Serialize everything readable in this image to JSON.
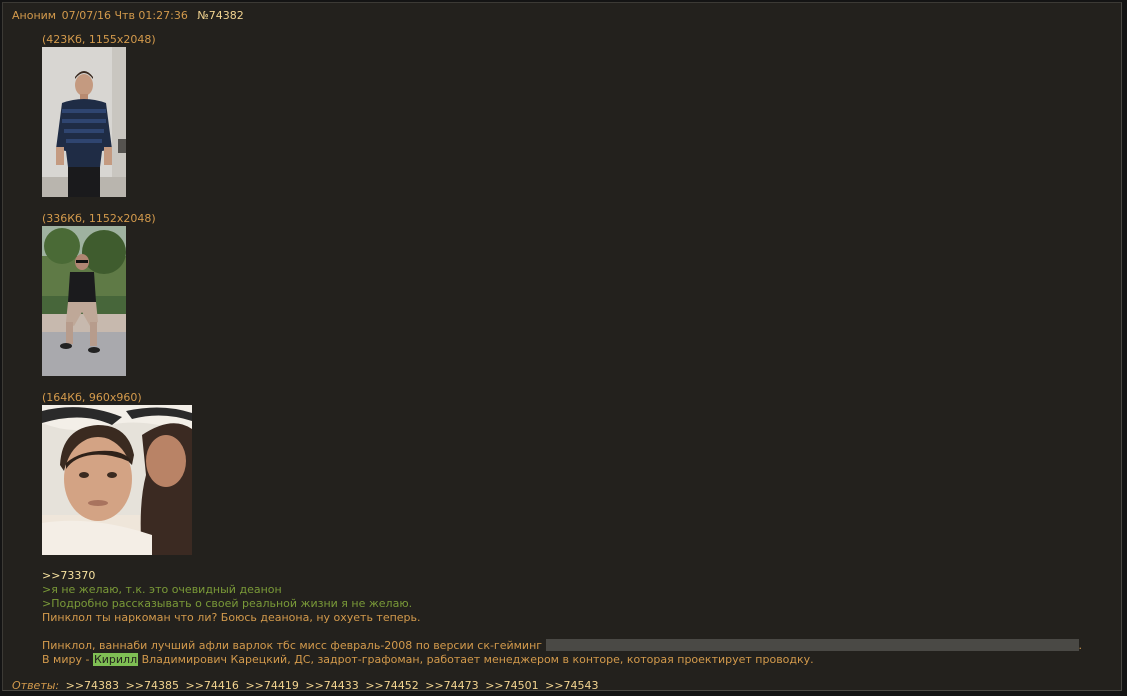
{
  "post": {
    "author": "Аноним",
    "date": "07/07/16 Чтв 01:27:36",
    "number": "№74382"
  },
  "files": [
    {
      "info": "(423Кб, 1155x2048)",
      "icon": "photo-standing-man"
    },
    {
      "info": "(336Кб, 1152x2048)",
      "icon": "photo-sitting-man"
    },
    {
      "info": "(164Кб, 960x960)",
      "icon": "photo-selfie-couple"
    }
  ],
  "body": {
    "reply_ref": ">>73370",
    "quote1": ">я не желаю, т.к. это очевидный деанон",
    "quote2": ">Подробно рассказывать о своей реальной жизни я не желаю.",
    "line1": "Пинклол ты наркоман что ли? Боюсь деанона, ну охуеть теперь.",
    "line2_prefix": "Пинклол, ваннаби лучший афли варлок тбс мисс февраль-2008 по версии ск-гейминг",
    "line2_suffix": ".",
    "line3_prefix": "В миру - ",
    "line3_highlight": "Кирилл",
    "line3_suffix": " Владимирович Карецкий, ДС, задрот-графоман, работает менеджером в конторе, которая проектирует проводку."
  },
  "replies": {
    "label": "Ответы:",
    "links": [
      ">>74383",
      ">>74385",
      ">>74416",
      ">>74419",
      ">>74433",
      ">>74452",
      ">>74473",
      ">>74501",
      ">>74543"
    ]
  },
  "colors": {
    "background": "#23211d",
    "text": "#d39a4c",
    "link": "#f2d490",
    "greentext": "#7a9a38",
    "highlight": "#7fbf54"
  }
}
